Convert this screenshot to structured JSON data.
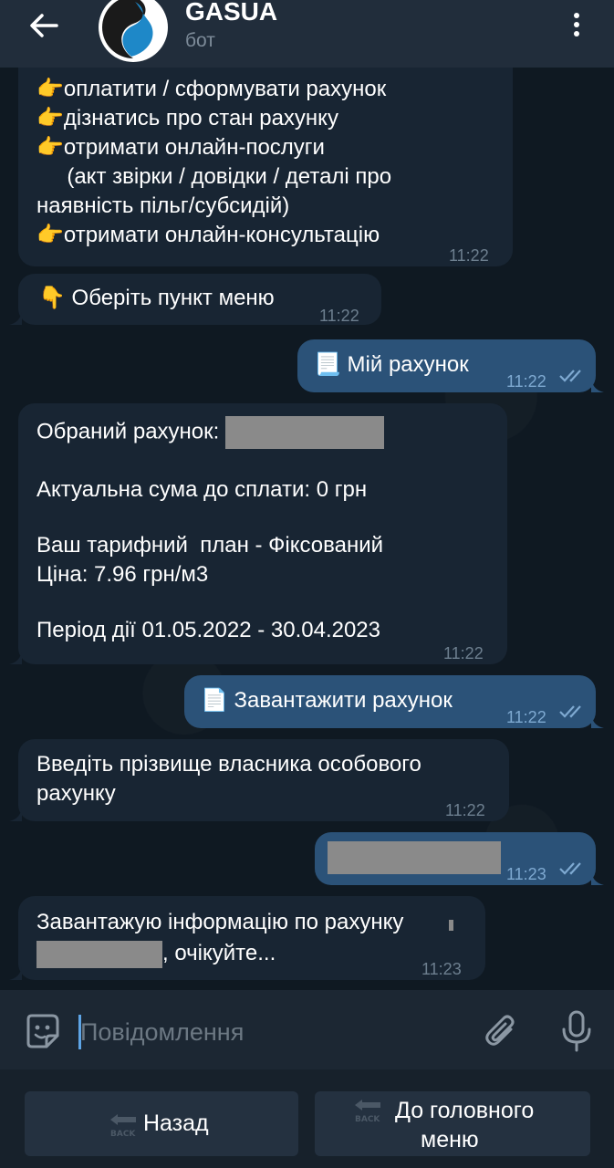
{
  "header": {
    "title": "GASUA",
    "subtitle": "бот"
  },
  "messages": {
    "m1": {
      "lines": [
        "👉оплатити / сформувати рахунок",
        "👉дізнатись про стан рахунку",
        "👉отримати онлайн-послуги",
        "     (акт звірки / довідки / деталі про",
        "наявність пільг/субсидій)",
        "👉отримати онлайн-консультацію"
      ],
      "time": "11:22"
    },
    "m2": {
      "text": "👇 Оберіть пункт меню",
      "time": "11:22"
    },
    "m3": {
      "text": "📃 Мій рахунок",
      "time": "11:22"
    },
    "m4": {
      "label_account": "Обраний рахунок:",
      "amount": "Актуальна сума до сплати: 0 грн",
      "plan": "Ваш тарифний  план - Фіксований",
      "price": "Ціна: 7.96 грн/м3",
      "period": "Період дії 01.05.2022 - 30.04.2023",
      "time": "11:22"
    },
    "m5": {
      "text": "📄 Завантажити рахунок",
      "time": "11:22"
    },
    "m6": {
      "lines": [
        "Введіть прізвище власника особового",
        "рахунку"
      ],
      "time": "11:22"
    },
    "m7": {
      "time": "11:23"
    },
    "m8": {
      "line1": "Завантажую інформацію по рахунку",
      "line2_suffix": ", очікуйте...",
      "time": "11:23"
    }
  },
  "input": {
    "placeholder": "Повідомлення"
  },
  "keyboard": {
    "back": {
      "label": "Назад",
      "icon_text": "BACK"
    },
    "home": {
      "label_line1": "До головного",
      "label_line2": "меню",
      "icon_text": "BACK"
    }
  },
  "colors": {
    "header": "#212d3b",
    "incoming_bubble": "#182533",
    "outgoing_bubble": "#2b5278",
    "accent": "#5ea5e6"
  },
  "icons": [
    "arrow-left-icon",
    "gasua-logo",
    "more-vert-icon",
    "double-check-icon",
    "sticker-icon",
    "paperclip-icon",
    "mic-icon",
    "back-arrow-icon"
  ]
}
